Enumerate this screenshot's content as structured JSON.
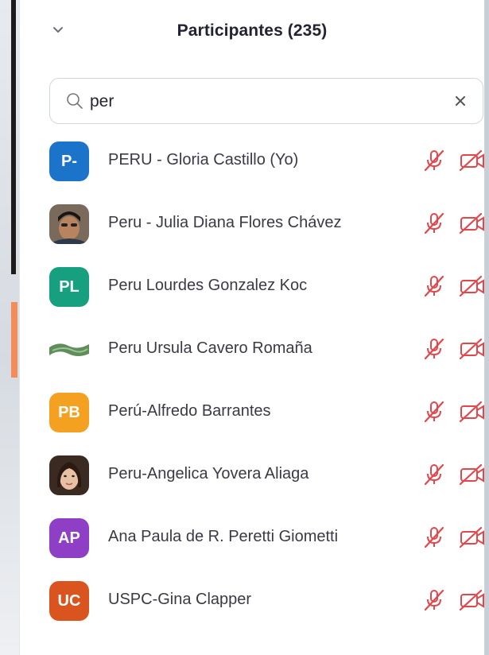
{
  "panel": {
    "title": "Participantes (235)"
  },
  "search": {
    "value": "per"
  },
  "participants": [
    {
      "name": "PERU - Gloria Castillo (Yo)",
      "initials": "P-",
      "avatar_color": "#1b74c9",
      "avatar_type": "initials"
    },
    {
      "name": "Peru - Julia Diana Flores Chávez",
      "initials": "",
      "avatar_color": "#6b4a3a",
      "avatar_type": "photo"
    },
    {
      "name": "Peru Lourdes Gonzalez Koc",
      "initials": "PL",
      "avatar_color": "#16a07f",
      "avatar_type": "initials"
    },
    {
      "name": "Peru Ursula Cavero Romaña",
      "initials": "",
      "avatar_color": "#5f8e5b",
      "avatar_type": "photo"
    },
    {
      "name": "Perú-Alfredo Barrantes",
      "initials": "PB",
      "avatar_color": "#f4a020",
      "avatar_type": "initials"
    },
    {
      "name": "Peru-Angelica Yovera Aliaga",
      "initials": "",
      "avatar_color": "#4a3228",
      "avatar_type": "photo"
    },
    {
      "name": "Ana Paula de R. Peretti Giometti",
      "initials": "AP",
      "avatar_color": "#8e3fc6",
      "avatar_type": "initials"
    },
    {
      "name": "USPC-Gina Clapper",
      "initials": "UC",
      "avatar_color": "#d9541f",
      "avatar_type": "initials"
    }
  ],
  "colors": {
    "muted_icon": "#e2474c",
    "accent_bar": "#f28c5a"
  },
  "icons": {
    "mic": "mic-muted-icon",
    "video": "video-off-icon"
  }
}
